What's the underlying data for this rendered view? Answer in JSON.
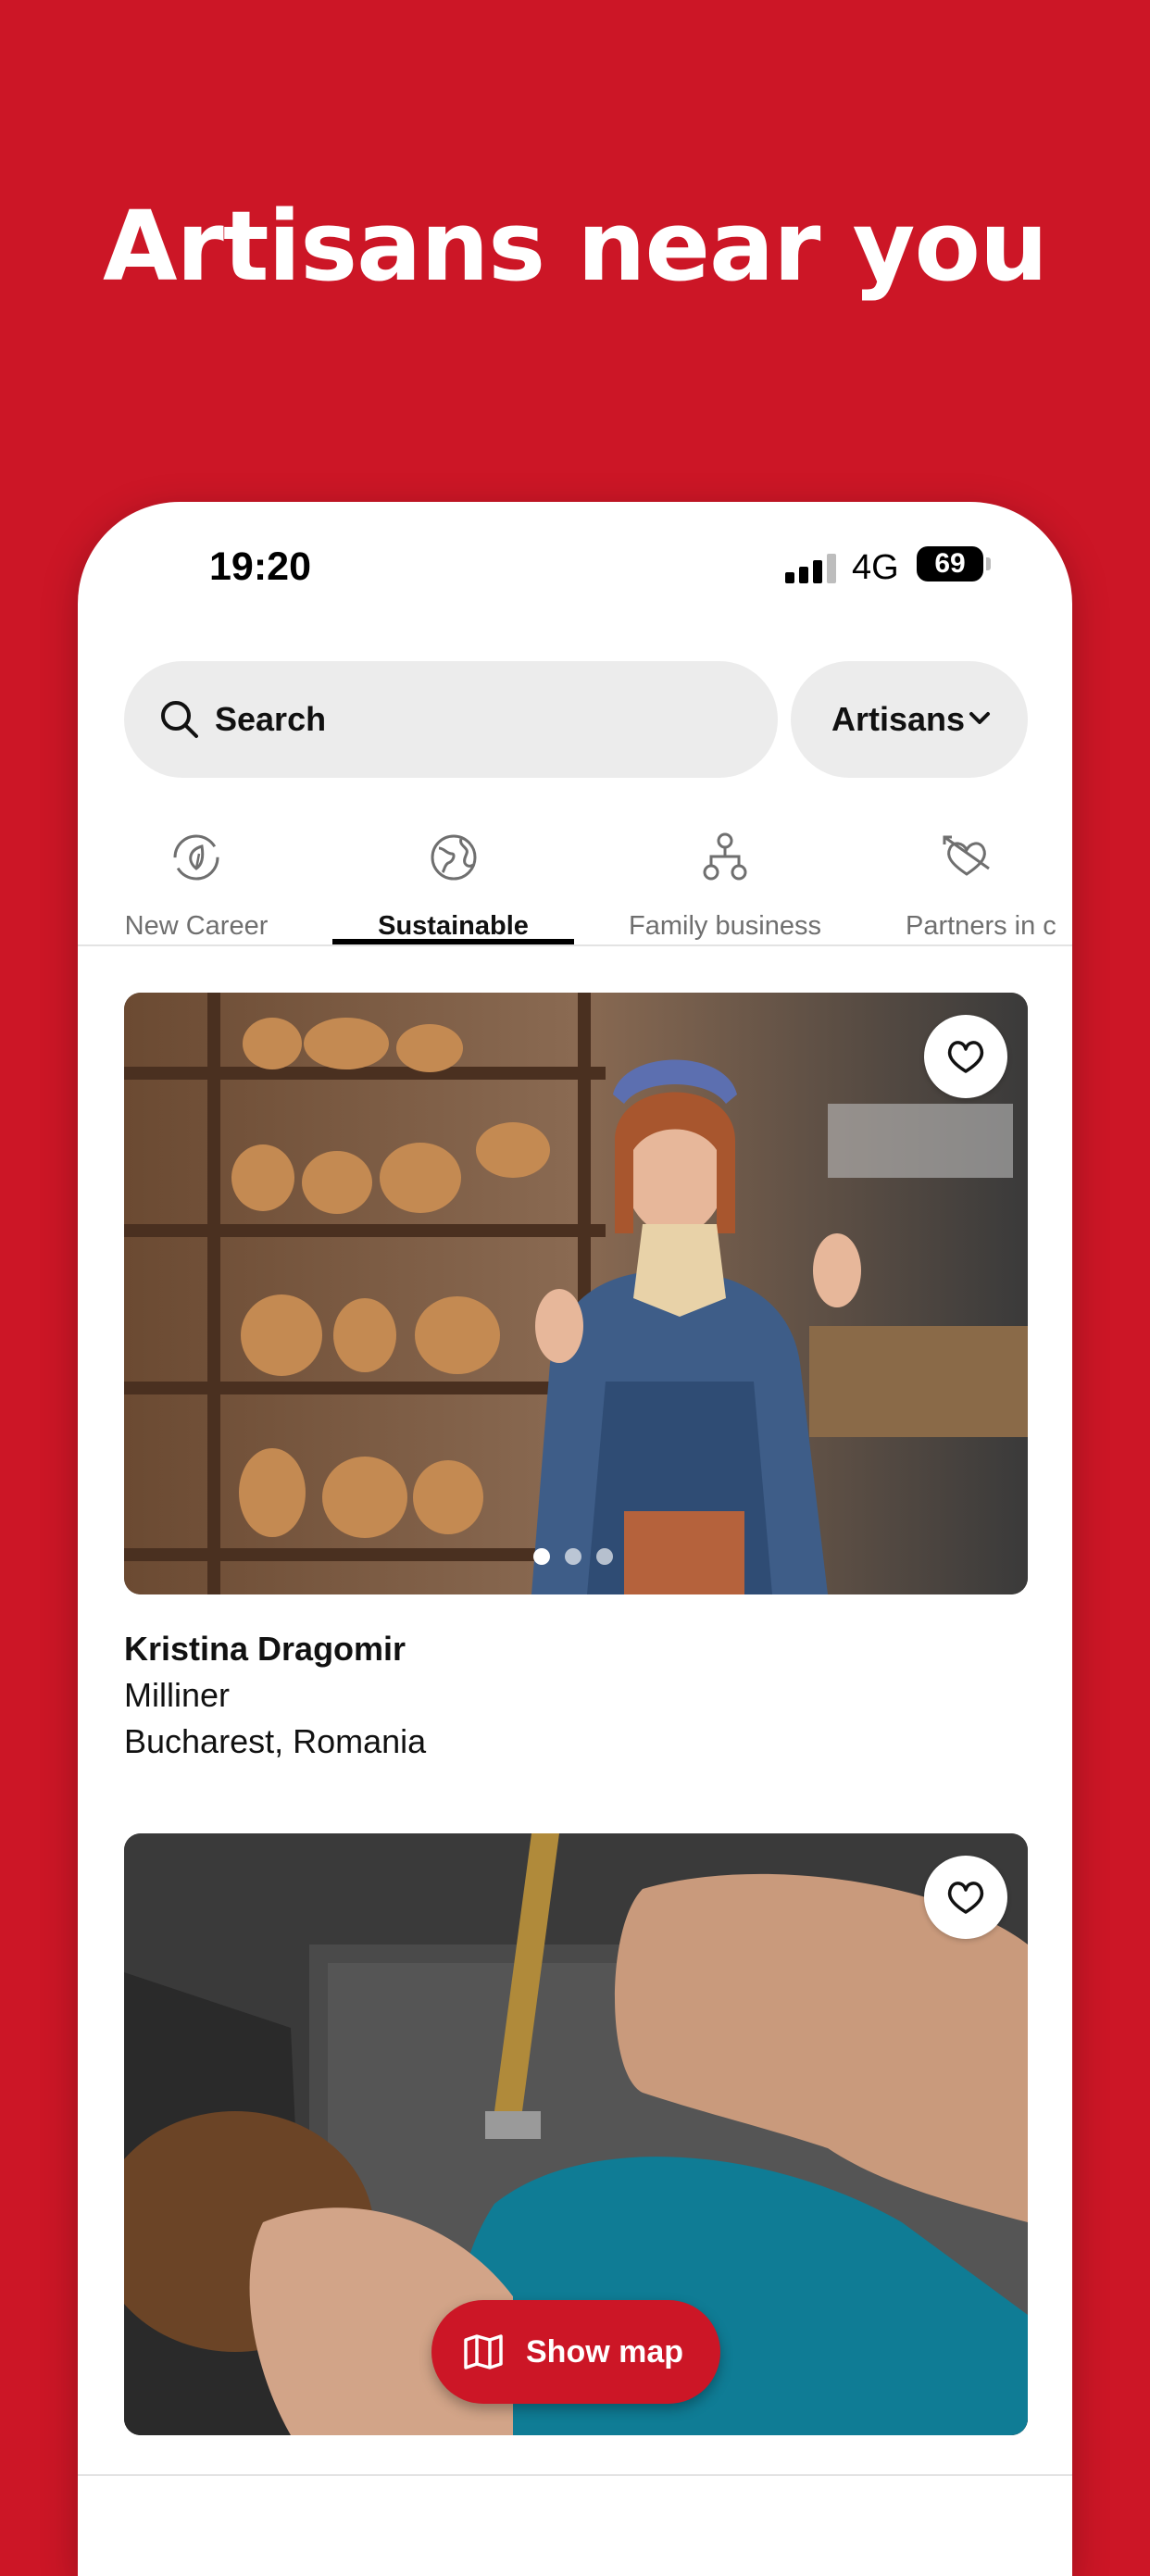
{
  "promo": {
    "headline": "Artisans near you"
  },
  "status_bar": {
    "time": "19:20",
    "network": "4G",
    "battery": "69"
  },
  "search": {
    "label": "Search"
  },
  "filter": {
    "label": "Artisans"
  },
  "tabs": [
    {
      "label": "New Career",
      "icon": "leaf-cycle-icon",
      "active": false
    },
    {
      "label": "Sustainable",
      "icon": "globe-icon",
      "active": true
    },
    {
      "label": "Family business",
      "icon": "family-tree-icon",
      "active": false
    },
    {
      "label": "Partners in c",
      "icon": "heart-arrow-icon",
      "active": false
    }
  ],
  "cards": [
    {
      "name": "Kristina Dragomir",
      "craft": "Milliner",
      "location": "Bucharest, Romania",
      "image_pages": 3,
      "current_page": 1
    },
    {
      "image": "leather-tooling-photo"
    }
  ],
  "map_button": {
    "label": "Show map",
    "icon": "map-icon"
  },
  "colors": {
    "brand_red": "#cc1626",
    "chip_bg": "#ececec",
    "white": "#ffffff"
  }
}
